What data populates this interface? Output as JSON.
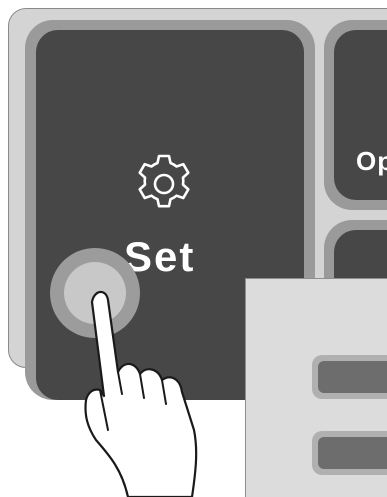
{
  "tiles": {
    "set": {
      "label": "Set",
      "icon": "gear-icon"
    },
    "operation": {
      "label": "Op"
    }
  },
  "colors": {
    "panel_bg": "#d4d4d4",
    "tile_border": "#9a9a9a",
    "tile_bg": "#474747",
    "text": "#ffffff",
    "inset_bg": "#dcdcdc",
    "inset_button": "#6d6d6d"
  }
}
